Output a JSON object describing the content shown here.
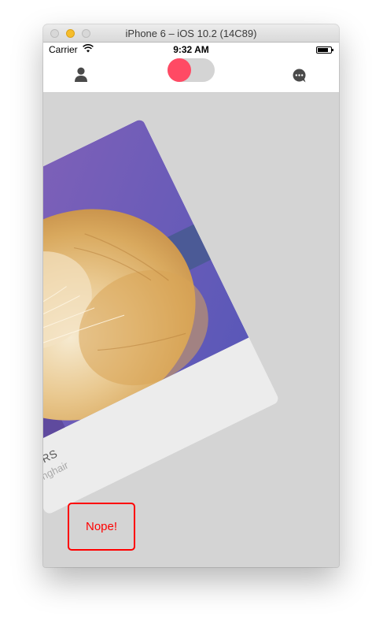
{
  "window": {
    "title": "iPhone 6 – iOS 10.2 (14C89)"
  },
  "status_bar": {
    "carrier": "Carrier",
    "time": "9:32 AM"
  },
  "nav": {
    "left_icon": "profile-icon",
    "right_icon": "messages-icon",
    "toggle": {
      "on": true,
      "knob_color": "#ff4a64"
    }
  },
  "card": {
    "name": "ARS",
    "breed": "nghair",
    "photo": "long-haired orange and cream cat"
  },
  "stamp": {
    "label": "Nope!",
    "color": "#ff0000"
  },
  "colors": {
    "background": "#d4d4d4",
    "card": "#ececec",
    "accent": "#ff4a64"
  }
}
